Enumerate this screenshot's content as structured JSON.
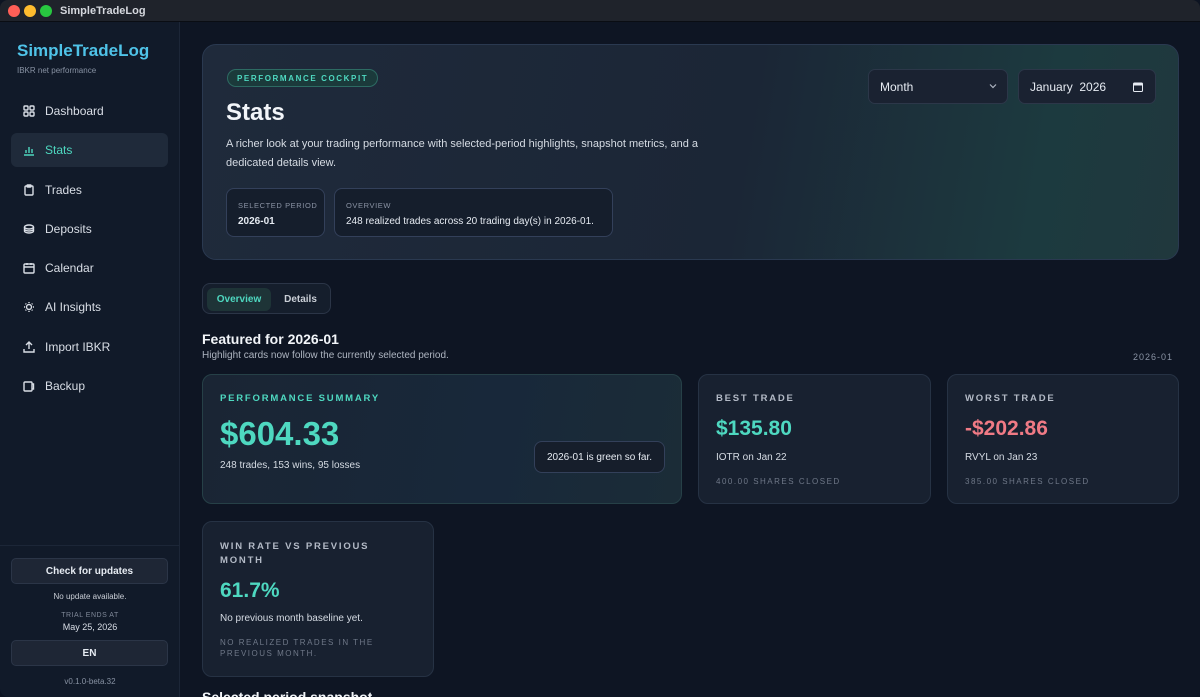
{
  "window": {
    "title": "SimpleTradeLog"
  },
  "sidebar": {
    "brand": "SimpleTradeLog",
    "brand_sub": "IBKR net performance",
    "items": [
      {
        "label": "Dashboard",
        "icon": "grid-icon",
        "active": false
      },
      {
        "label": "Stats",
        "icon": "bar-chart-icon",
        "active": true
      },
      {
        "label": "Trades",
        "icon": "clipboard-icon",
        "active": false
      },
      {
        "label": "Deposits",
        "icon": "coins-icon",
        "active": false
      },
      {
        "label": "Calendar",
        "icon": "calendar-icon",
        "active": false
      },
      {
        "label": "AI Insights",
        "icon": "lightbulb-icon",
        "active": false
      },
      {
        "label": "Import IBKR",
        "icon": "upload-icon",
        "active": false
      },
      {
        "label": "Backup",
        "icon": "backup-icon",
        "active": false
      }
    ],
    "update_button": "Check for updates",
    "update_status": "No update available.",
    "trial_label": "TRIAL ENDS AT",
    "trial_date": "May 25, 2026",
    "language": "EN",
    "version": "v0.1.0-beta.32"
  },
  "hero": {
    "badge": "PERFORMANCE COCKPIT",
    "title": "Stats",
    "description": "A richer look at your trading performance with selected-period highlights, snapshot metrics, and a dedicated details view.",
    "period_select": "Month",
    "date_value": "January  2026",
    "selected_period_label": "SELECTED PERIOD",
    "selected_period": "2026-01",
    "overview_label": "OVERVIEW",
    "overview": "248 realized trades across 20 trading day(s) in 2026-01."
  },
  "tabs": {
    "overview": "Overview",
    "details": "Details"
  },
  "featured": {
    "title": "Featured for 2026-01",
    "subtitle": "Highlight cards now follow the currently selected period.",
    "period": "2026-01"
  },
  "cards": {
    "summary": {
      "label": "PERFORMANCE SUMMARY",
      "value": "$604.33",
      "sub": "248 trades, 153 wins, 95 losses",
      "badge": "2026-01 is green so far."
    },
    "best": {
      "label": "BEST TRADE",
      "value": "$135.80",
      "line": "IOTR on Jan 22",
      "note": "400.00 SHARES CLOSED"
    },
    "worst": {
      "label": "WORST TRADE",
      "value": "-$202.86",
      "line": "RVYL on Jan 23",
      "note": "385.00 SHARES CLOSED"
    },
    "winrate": {
      "label": "WIN RATE VS PREVIOUS MONTH",
      "value": "61.7%",
      "line": "No previous month baseline yet.",
      "note": "NO REALIZED TRADES IN THE PREVIOUS MONTH."
    }
  },
  "next_section": "Selected period snapshot",
  "colors": {
    "accent": "#4ed8c0",
    "negative": "#f07a85",
    "brand": "#4fc3e8"
  }
}
